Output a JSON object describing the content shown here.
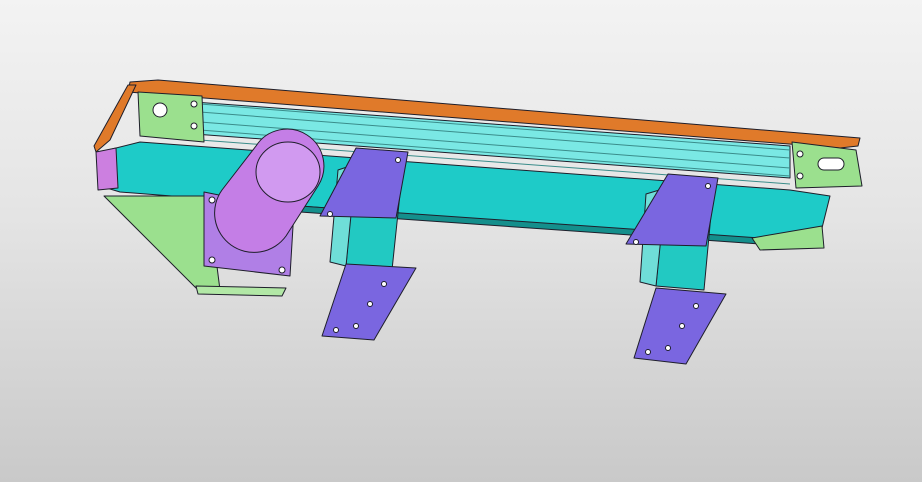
{
  "viewport": {
    "background_top": "#f3f3f3",
    "background_bottom": "#c9c9c9"
  },
  "model": {
    "parts": [
      {
        "name": "conveyor-belt-top",
        "color": "#e07a2a"
      },
      {
        "name": "conveyor-frame-profile",
        "color": "#1fd0cf"
      },
      {
        "name": "end-plate-left",
        "color": "#9be08e"
      },
      {
        "name": "end-plate-right",
        "color": "#9be08e"
      },
      {
        "name": "drive-motor",
        "color": "#c47ee6"
      },
      {
        "name": "motor-mount-bracket",
        "color": "#9be08e"
      },
      {
        "name": "support-leg",
        "color": "#22c9c2"
      },
      {
        "name": "leg-foot-plate",
        "color": "#7a66e0"
      }
    ]
  }
}
